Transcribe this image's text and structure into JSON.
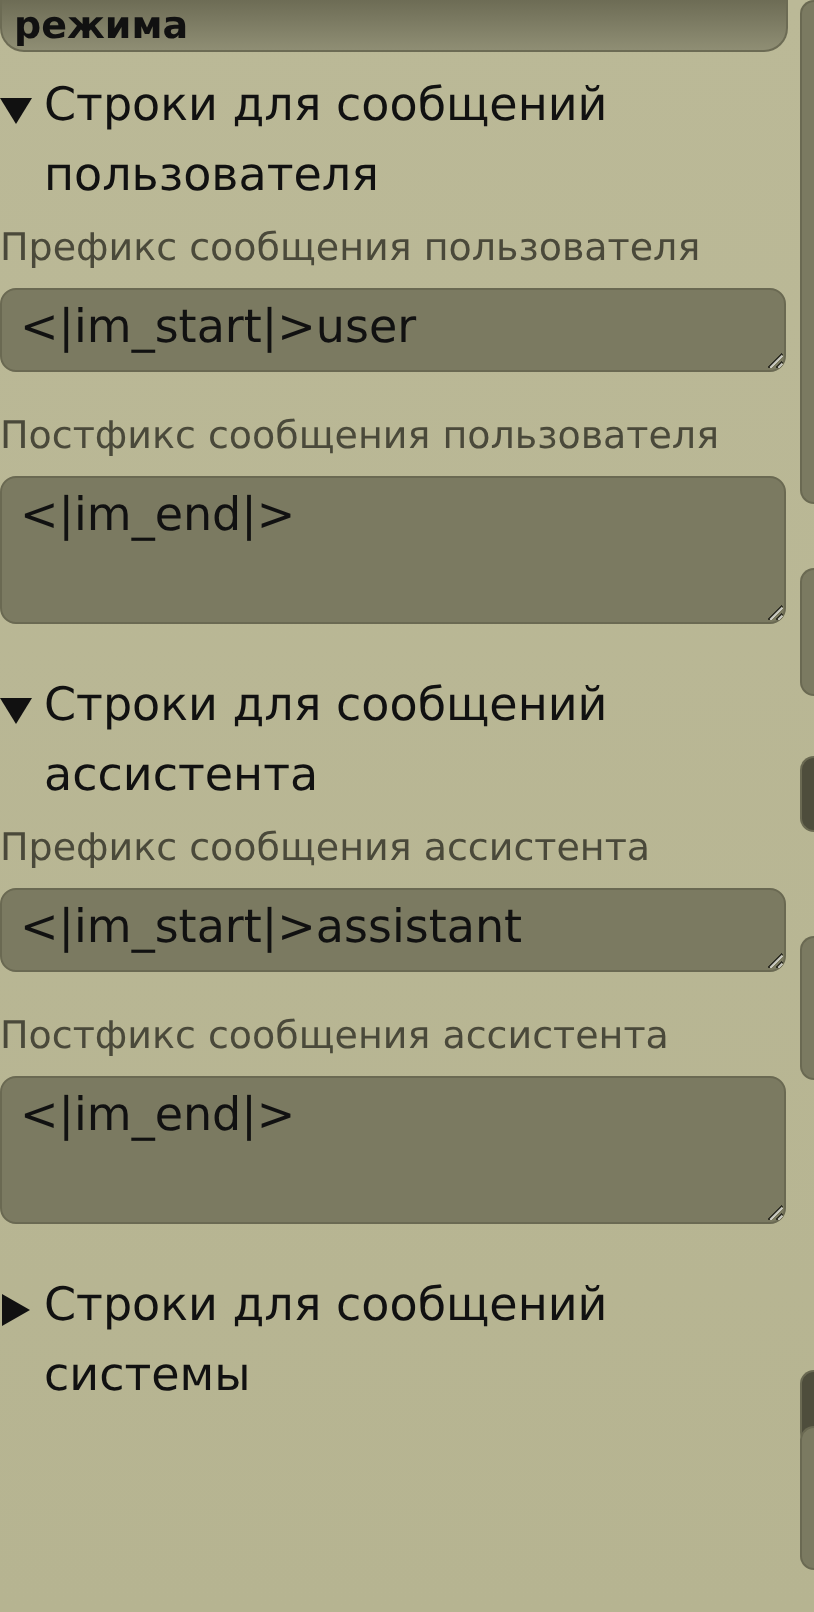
{
  "top_button": {
    "label": "режима"
  },
  "sections": [
    {
      "title": "Строки для сообщений пользователя",
      "expanded": true,
      "fields": [
        {
          "label": "Префикс сообщения пользователя",
          "value": "<|im_start|>user",
          "kind": "short"
        },
        {
          "label": "Постфикс сообщения пользователя",
          "value": "<|im_end|>",
          "kind": "tall"
        }
      ]
    },
    {
      "title": "Строки для сообщений ассистента",
      "expanded": true,
      "fields": [
        {
          "label": "Префикс сообщения ассистента",
          "value": "<|im_start|>assistant",
          "kind": "short"
        },
        {
          "label": "Постфикс сообщения ассистента",
          "value": "<|im_end|>",
          "kind": "tall"
        }
      ]
    },
    {
      "title": "Строки для сообщений системы",
      "expanded": false
    }
  ]
}
